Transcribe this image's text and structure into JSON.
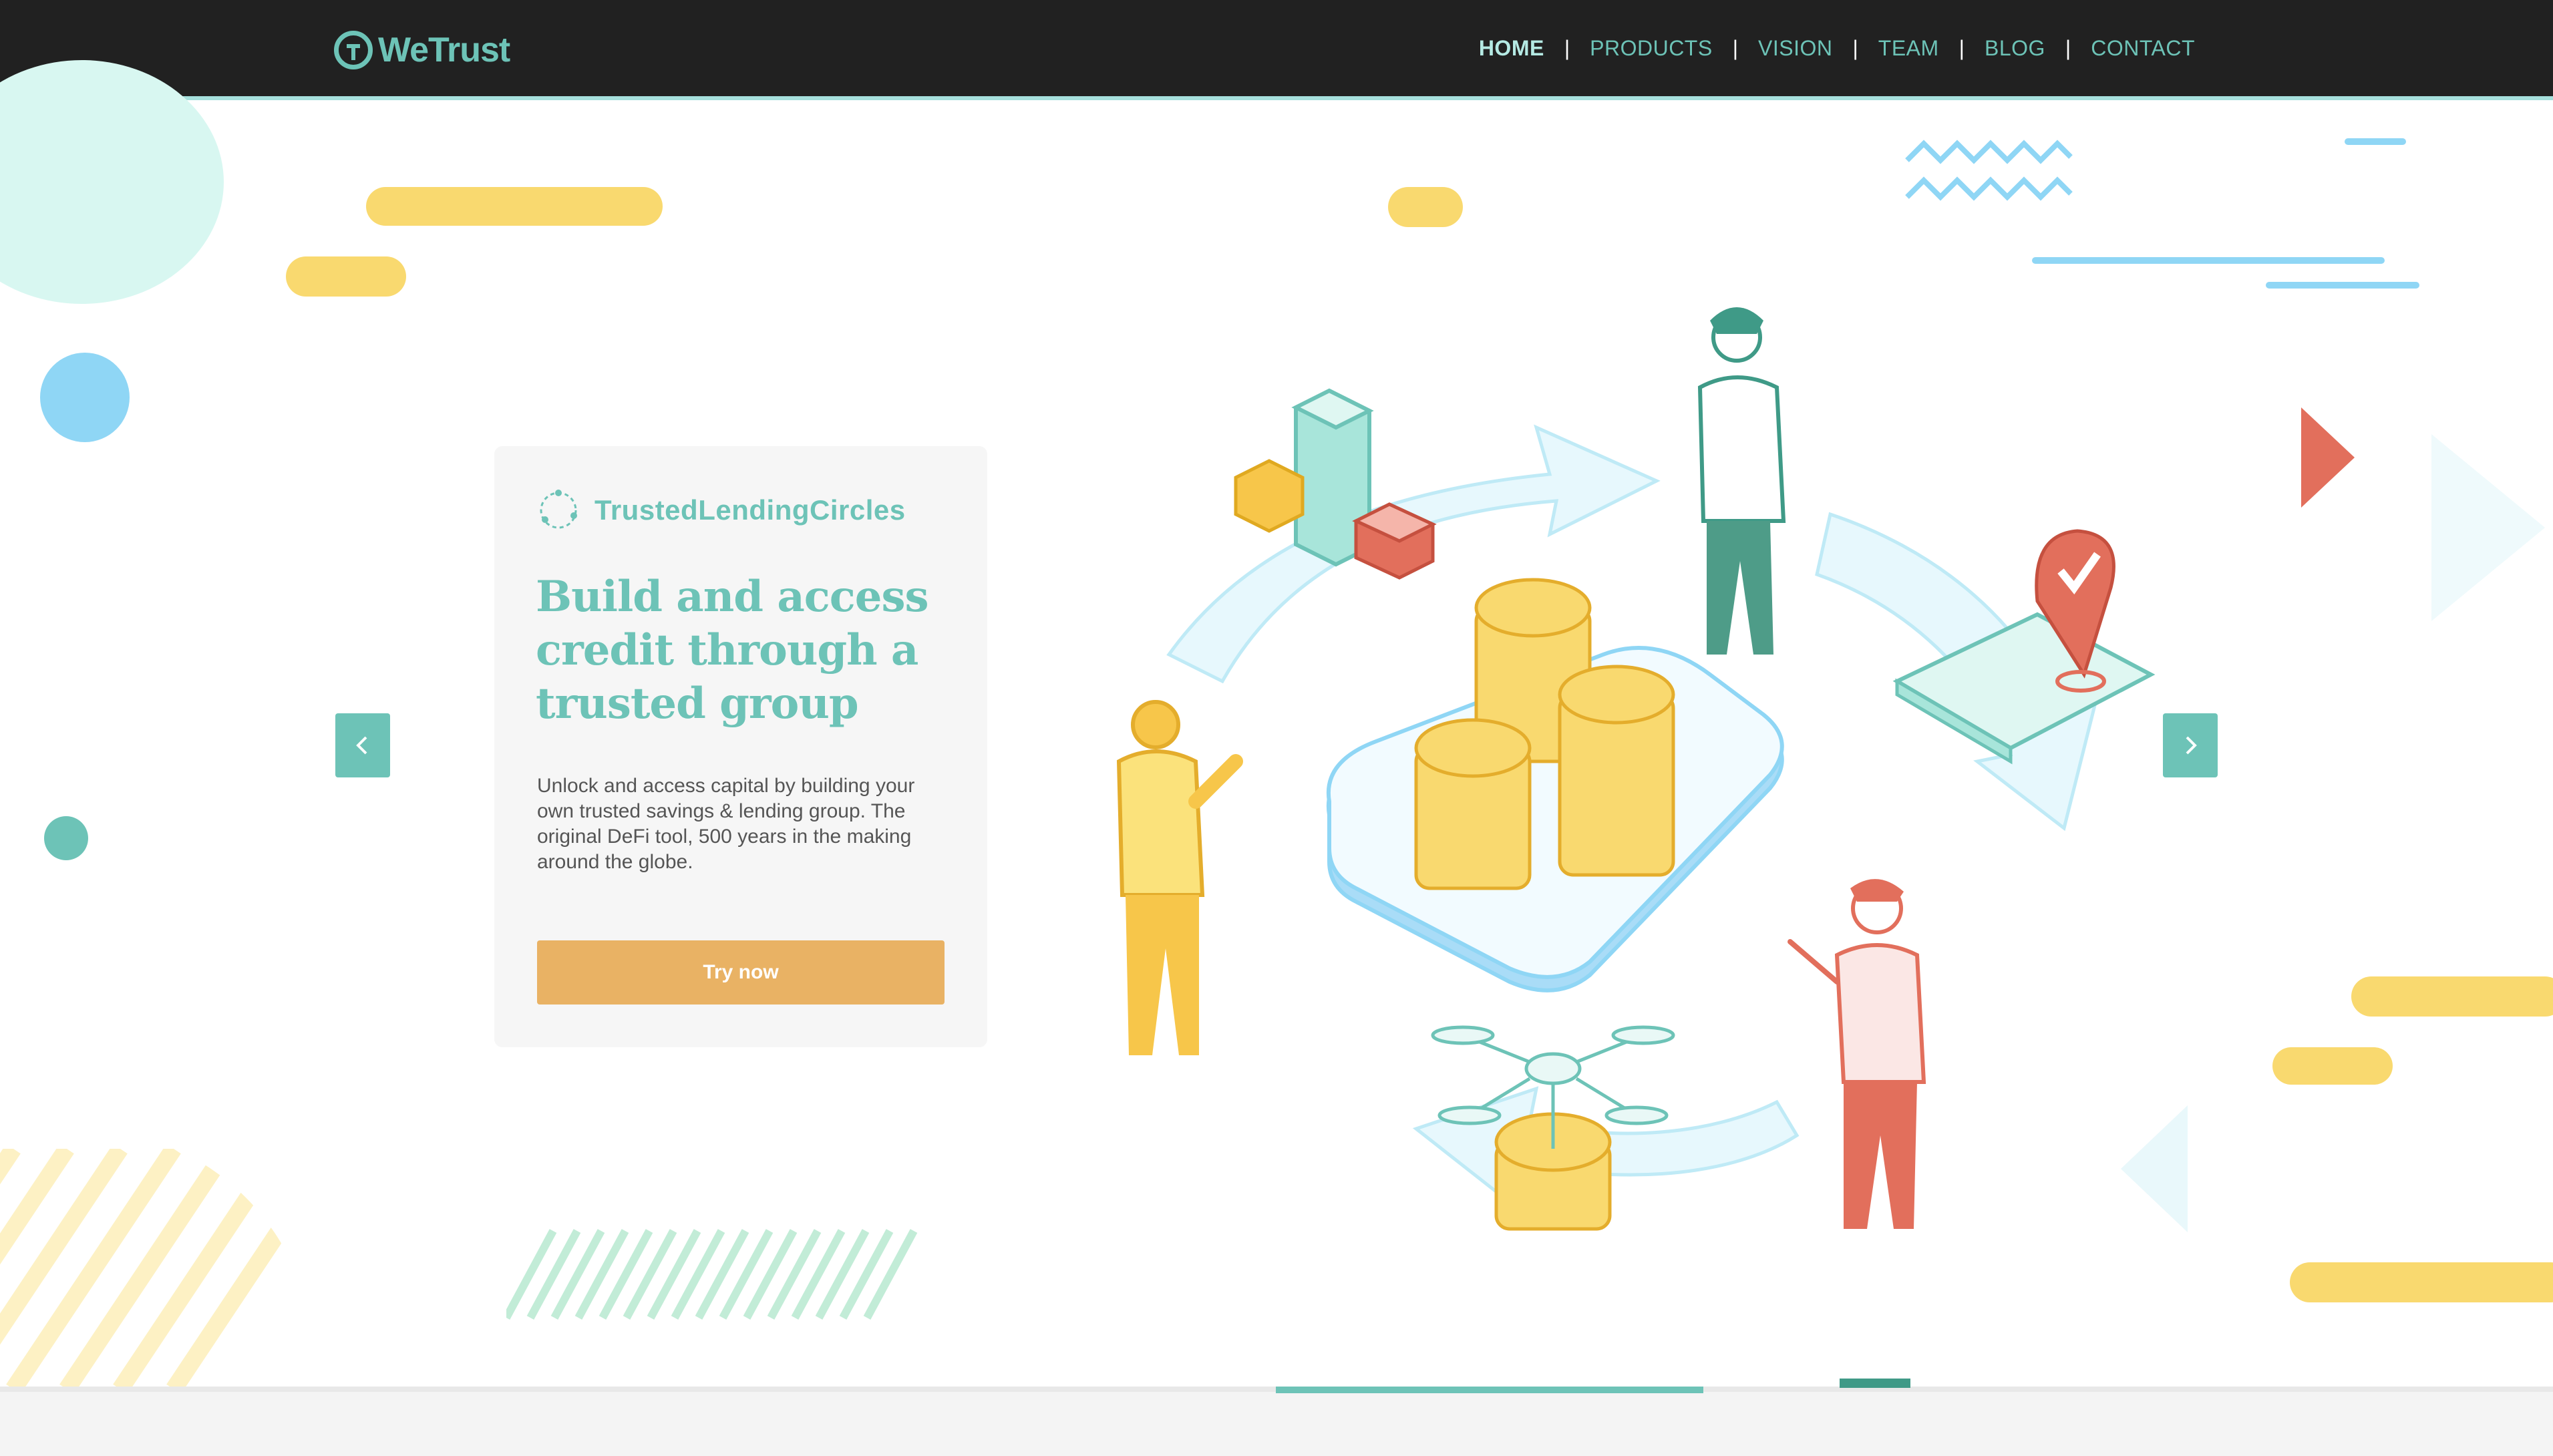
{
  "header": {
    "logo_text": "WeTrust",
    "logo_icon": "wetrust-t-logo",
    "menu": [
      {
        "label": "HOME",
        "active": true
      },
      {
        "label": "PRODUCTS",
        "active": false
      },
      {
        "label": "VISION",
        "active": false
      },
      {
        "label": "TEAM",
        "active": false
      },
      {
        "label": "BLOG",
        "active": false
      },
      {
        "label": "CONTACT",
        "active": false
      }
    ],
    "separator": "|"
  },
  "slide": {
    "brand_icon": "circle-dots-icon",
    "brand_name": "TrustedLendingCircles",
    "headline": "Build and access credit through a trusted group",
    "description": "Unlock and access capital by building your own trusted savings & lending group. The original DeFi tool, 500 years in the making around the globe.",
    "cta_label": "Try now",
    "prev_icon": "chevron-left-icon",
    "next_icon": "chevron-right-icon",
    "progress": 0.33
  },
  "colors": {
    "teal": "#6dc3b7",
    "dark_header": "#212121",
    "cta_orange": "#e9b264",
    "yellow": "#f9d96f",
    "light_blue": "#8fd6f5",
    "coral": "#e26f5c",
    "mint": "#d8f7f1"
  }
}
